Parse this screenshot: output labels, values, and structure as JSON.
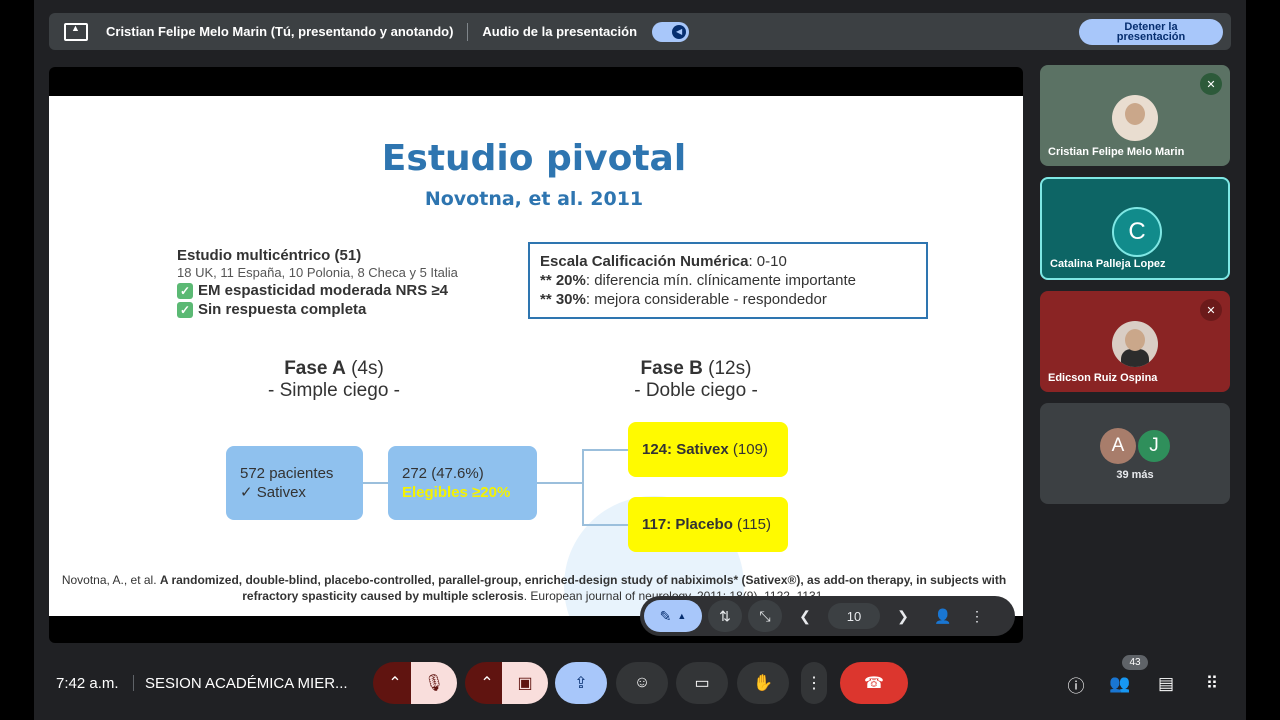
{
  "present_bar": {
    "presenter": "Cristian Felipe Melo Marin (Tú, presentando y anotando)",
    "audio_label": "Audio de la presentación",
    "stop_line1": "Detener la",
    "stop_line2": "presentación"
  },
  "slide": {
    "title": "Estudio pivotal",
    "subtitle": "Novotna, et al. 2011",
    "multicenter_title": "Estudio multicéntrico (51)",
    "multicenter_detail": "18 UK, 11 España, 10 Polonia, 8 Checa y 5 Italia",
    "criteria": [
      "EM espasticidad moderada NRS ≥4",
      "Sin respuesta completa"
    ],
    "scale_title_bold": "Escala Calificación Numérica",
    "scale_title_rest": ": 0-10",
    "scale_line1_bold": "** 20%",
    "scale_line1_rest": ": diferencia mín. clínicamente importante",
    "scale_line2_bold": "** 30%",
    "scale_line2_rest": ": mejora considerable - respondedor",
    "phase_a_bold": "Fase A",
    "phase_a_dur": " (4s)",
    "phase_a_type": "- Simple ciego -",
    "phase_b_bold": "Fase B",
    "phase_b_dur": " (12s)",
    "phase_b_type": "- Doble ciego -",
    "box_patients_1": "572 pacientes",
    "box_patients_2": "✓ Sativex",
    "box_eligible_1": "272 (47.6%)",
    "box_eligible_2": "Elegibles ≥20%",
    "sativex_bold": "124: Sativex",
    "sativex_rest": " (109)",
    "placebo_bold": "117: Placebo",
    "placebo_rest": " (115)",
    "citation_plain": "Novotna, A., et al. ",
    "citation_bold": "A randomized, double-blind, placebo-controlled, parallel-group, enriched-design study of nabiximols* (Sativex®), as add-on therapy, in subjects with refractory spasticity caused by multiple sclerosis",
    "citation_tail": ". European journal of neurology, 2011; 18(9), 1122–1131."
  },
  "slide_controls": {
    "page": "10"
  },
  "participants": [
    {
      "name": "Cristian Felipe Melo Marin"
    },
    {
      "name": "Catalina Palleja Lopez",
      "initial": "C"
    },
    {
      "name": "Edicson Ruiz Ospina"
    }
  ],
  "others": {
    "initial_a": "A",
    "initial_j": "J",
    "label": "39 más"
  },
  "bottom": {
    "time": "7:42 a.m.",
    "meeting": "SESION ACADÉMICA MIER...",
    "people_count": "43"
  },
  "colors": {
    "accent": "#a8c7fa",
    "slide_blue": "#2e75b0",
    "end_call": "#dc362e",
    "highlight_yellow": "#fffa00"
  }
}
